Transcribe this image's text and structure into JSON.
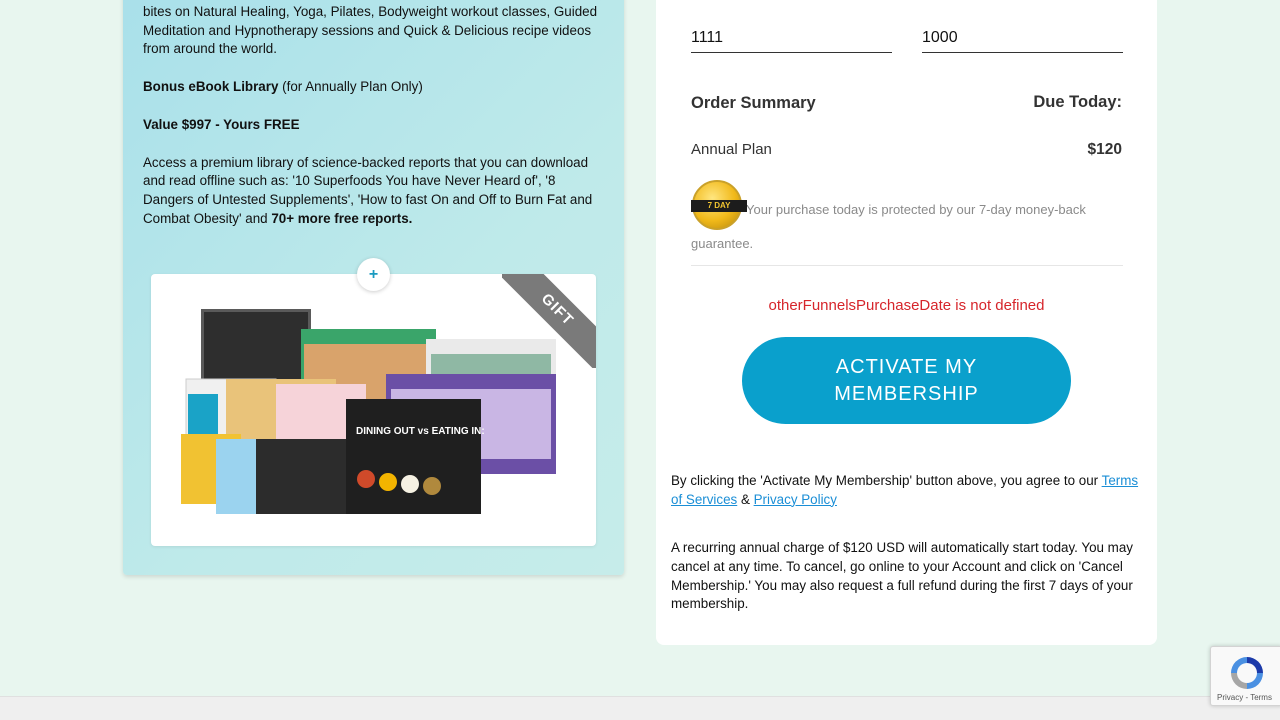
{
  "left": {
    "intro": "bites on Natural Healing, Yoga, Pilates, Bodyweight workout classes, Guided Meditation and Hypnotherapy sessions and Quick & Delicious recipe videos from around the world.",
    "bonus_title": "Bonus eBook Library",
    "bonus_note": " (for Annually Plan Only)",
    "value_line": "Value $997 - Yours FREE",
    "access_text": "Access a premium library of science-backed reports that you can download and read offline such as: '10 Superfoods You have Never Heard of', '8 Dangers of Untested Supplements', 'How to fast On and Off to Burn Fat and Combat Obesity' and ",
    "access_bold": "70+ more free reports.",
    "plus_label": "+",
    "gift_label": "GIFT"
  },
  "form": {
    "field1_value": "1111",
    "field2_value": "1000"
  },
  "summary": {
    "title": "Order Summary",
    "due_label": "Due Today:",
    "plan_name": "Annual Plan",
    "plan_price": "$120",
    "badge_text": "7 DAY",
    "guarantee_text": "Your purchase today is protected by our 7-day money-back guarantee.",
    "error_text": "otherFunnelsPurchaseDate is not defined",
    "cta_label": "ACTIVATE MY MEMBERSHIP"
  },
  "legal": {
    "agree_prefix": "By clicking the 'Activate My Membership' button above, you agree to our ",
    "terms_link": "Terms of Services",
    "amp": " & ",
    "privacy_link": "Privacy Policy",
    "recurring_text": "A recurring annual charge of $120 USD will automatically start today. You may cancel at any time. To cancel, go online to your Account and click on 'Cancel Membership.' You may also request a full refund during the first 7 days of your membership."
  },
  "recaptcha": {
    "sub_text": "Privacy - Terms"
  },
  "colors": {
    "accent": "#0aa0cc",
    "error": "#d6252b",
    "page_bg": "#e8f6ef"
  }
}
